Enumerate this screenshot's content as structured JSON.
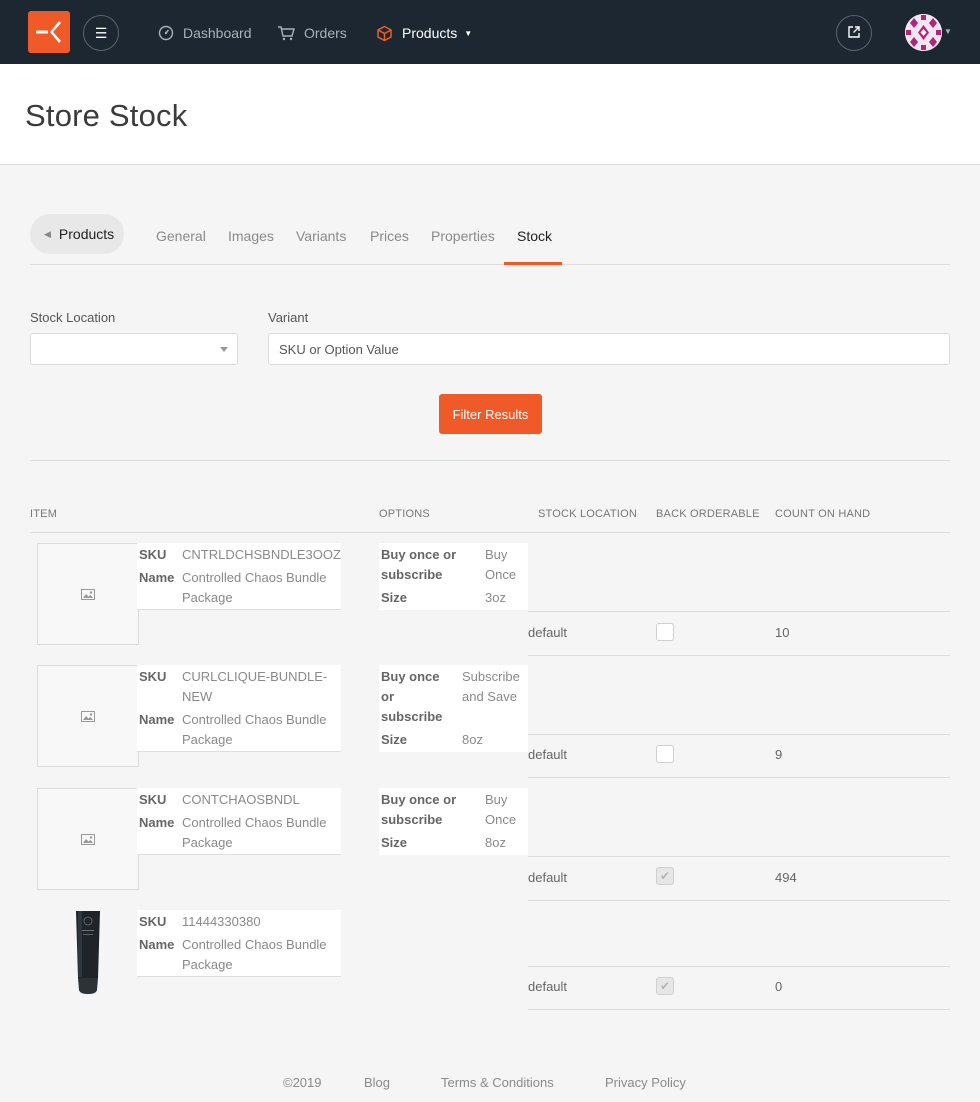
{
  "nav": {
    "dashboard": "Dashboard",
    "orders": "Orders",
    "products": "Products"
  },
  "page": {
    "title": "Store Stock"
  },
  "tabs": {
    "back": "Products",
    "items": [
      "General",
      "Images",
      "Variants",
      "Prices",
      "Properties",
      "Stock"
    ],
    "active": "Stock"
  },
  "filters": {
    "stock_location_label": "Stock Location",
    "variant_label": "Variant",
    "variant_placeholder": "SKU or Option Value",
    "submit": "Filter Results"
  },
  "table": {
    "headers": [
      "ITEM",
      "OPTIONS",
      "STOCK LOCATION",
      "BACK ORDERABLE",
      "COUNT ON HAND"
    ],
    "sku_label": "SKU",
    "name_label": "Name",
    "rows": [
      {
        "sku": "CNTRLDCHSBNDLE3OOZ",
        "name": "Controlled Chaos Bundle Package",
        "options": [
          {
            "k": "Buy once or subscribe",
            "v": "Buy Once"
          },
          {
            "k": "Size",
            "v": "3oz"
          }
        ],
        "location": "default",
        "backorderable": false,
        "count": "10"
      },
      {
        "sku": "CURLCLIQUE-BUNDLE-NEW",
        "name": "Controlled Chaos Bundle Package",
        "options": [
          {
            "k": "Buy once or subscribe",
            "v": "Subscribe and Save"
          },
          {
            "k": "Size",
            "v": "8oz"
          }
        ],
        "location": "default",
        "backorderable": false,
        "count": "9"
      },
      {
        "sku": "CONTCHAOSBNDL",
        "name": "Controlled Chaos Bundle Package",
        "options": [
          {
            "k": "Buy once or subscribe",
            "v": "Buy Once"
          },
          {
            "k": "Size",
            "v": "8oz"
          }
        ],
        "location": "default",
        "backorderable": true,
        "count": "494"
      },
      {
        "sku": "11444330380",
        "name": "Controlled Chaos Bundle Package",
        "options": [],
        "location": "default",
        "backorderable": true,
        "count": "0"
      }
    ]
  },
  "footer": {
    "copyright": "©2019",
    "blog": "Blog",
    "terms": "Terms & Conditions",
    "privacy": "Privacy Policy"
  },
  "colors": {
    "brand": "#f05a28",
    "topbar": "#1c2731"
  },
  "icons": [
    "logo-icon",
    "menu-icon",
    "dashboard-icon",
    "cart-icon",
    "box-icon",
    "external-link-icon",
    "image-placeholder-icon",
    "check-icon"
  ]
}
